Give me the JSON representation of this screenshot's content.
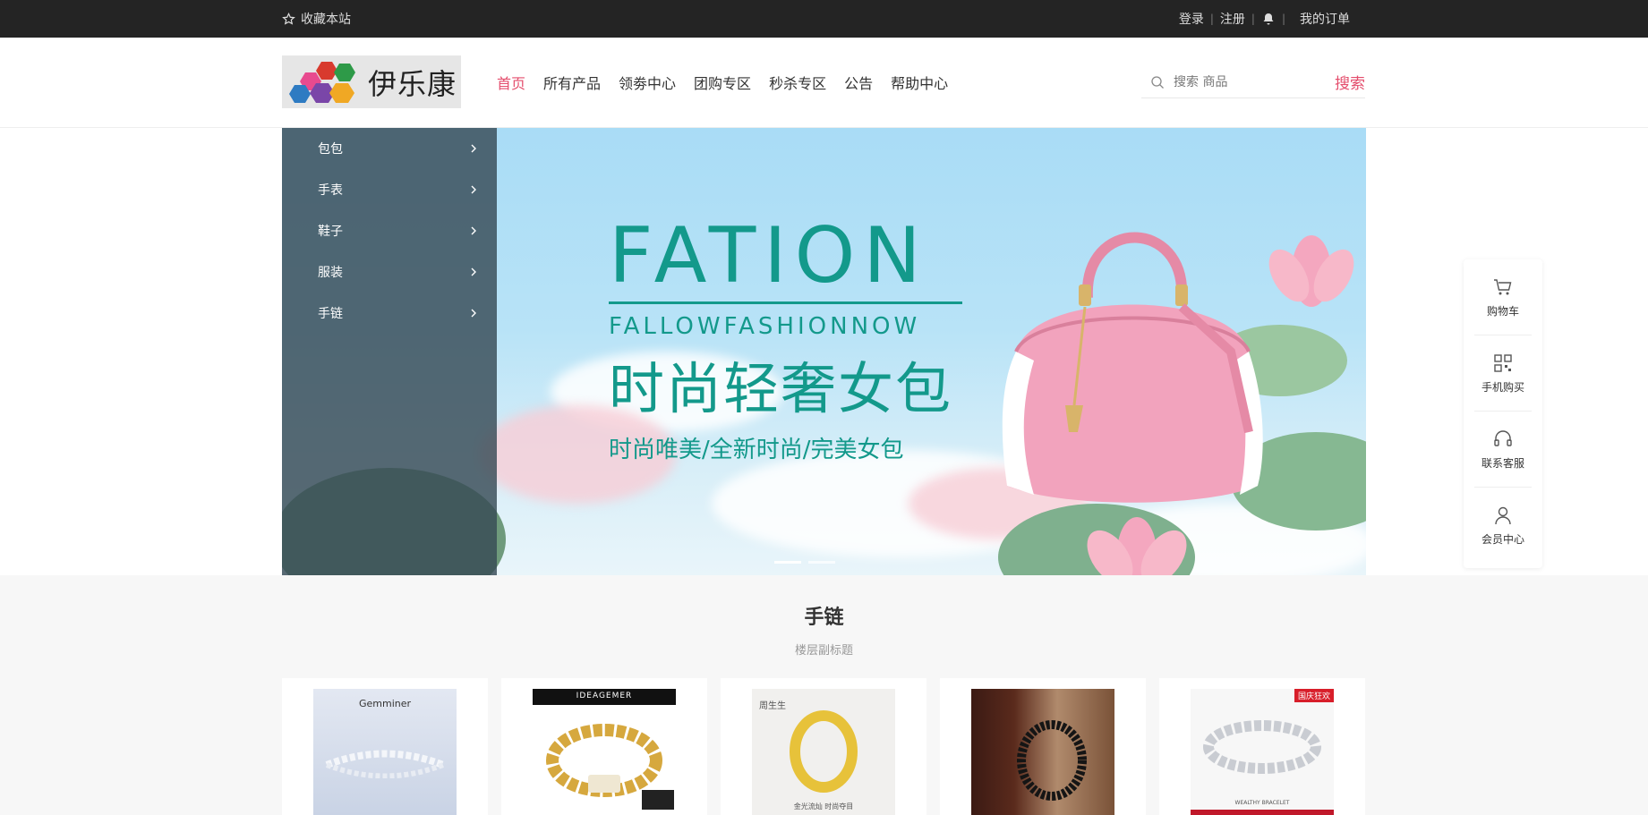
{
  "topbar": {
    "favorite_label": "收藏本站",
    "login": "登录",
    "register": "注册",
    "orders": "我的订单"
  },
  "header": {
    "logo_text": "伊乐康",
    "nav": [
      {
        "label": "首页",
        "active": true
      },
      {
        "label": "所有产品"
      },
      {
        "label": "领劵中心"
      },
      {
        "label": "团购专区"
      },
      {
        "label": "秒杀专区"
      },
      {
        "label": "公告"
      },
      {
        "label": "帮助中心"
      }
    ],
    "search_placeholder": "搜索 商品",
    "search_button": "搜索"
  },
  "category_menu": [
    "包包",
    "手表",
    "鞋子",
    "服装",
    "手链"
  ],
  "banner": {
    "headline": "FATION",
    "subline": "FALLOWFASHIONNOW",
    "cn_title": "时尚轻奢女包",
    "cn_sub": "时尚唯美/全新时尚/完美女包",
    "slides": 2,
    "active_slide": 1
  },
  "float_panel": [
    {
      "label": "购物车",
      "icon": "cart-icon"
    },
    {
      "label": "手机购买",
      "icon": "qrcode-icon"
    },
    {
      "label": "联系客服",
      "icon": "headset-icon"
    },
    {
      "label": "会员中心",
      "icon": "user-icon"
    }
  ],
  "floor": {
    "title": "手链",
    "subtitle": "楼层副标题",
    "products": [
      {
        "brand": "Gemminer",
        "caption": ""
      },
      {
        "brand": "IDEAGEMER",
        "caption": ""
      },
      {
        "brand": "周生生",
        "caption": "金光流灿 时尚夺目"
      },
      {
        "brand": "",
        "caption": ""
      },
      {
        "brand": "",
        "caption": "WEALTHY BRACELET",
        "badge": "国庆狂欢"
      }
    ]
  },
  "colors": {
    "accent": "#e44d6c",
    "banner_teal": "#13998b",
    "topbar_bg": "#242424"
  }
}
